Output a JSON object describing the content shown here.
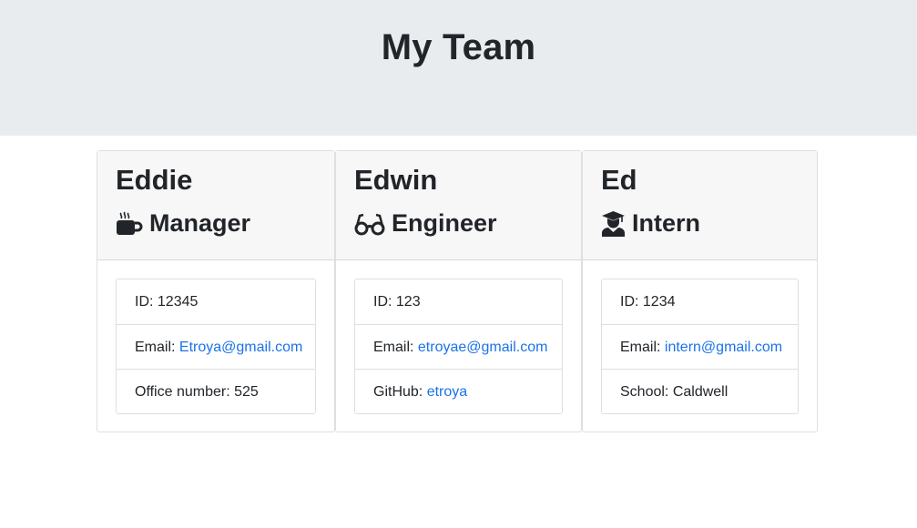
{
  "header": {
    "title": "My Team"
  },
  "colors": {
    "header_bg": "#e9ecef",
    "link": "#1a73e8",
    "card_header_bg": "#f7f7f7"
  },
  "cards": [
    {
      "name": "Eddie",
      "role": "Manager",
      "icon": "mug-icon",
      "id_label": "ID: ",
      "id": "12345",
      "email_label": "Email: ",
      "email": "Etroya@gmail.com",
      "extra_label": "Office number: ",
      "extra_value": "525"
    },
    {
      "name": "Edwin",
      "role": "Engineer",
      "icon": "glasses-icon",
      "id_label": "ID: ",
      "id": "123",
      "email_label": "Email: ",
      "email": "etroyae@gmail.com",
      "extra_label": "GitHub: ",
      "extra_value": "etroya"
    },
    {
      "name": "Ed",
      "role": "Intern",
      "icon": "graduate-icon",
      "id_label": "ID: ",
      "id": "1234",
      "email_label": "Email: ",
      "email": "intern@gmail.com",
      "extra_label": "School: ",
      "extra_value": "Caldwell"
    }
  ]
}
